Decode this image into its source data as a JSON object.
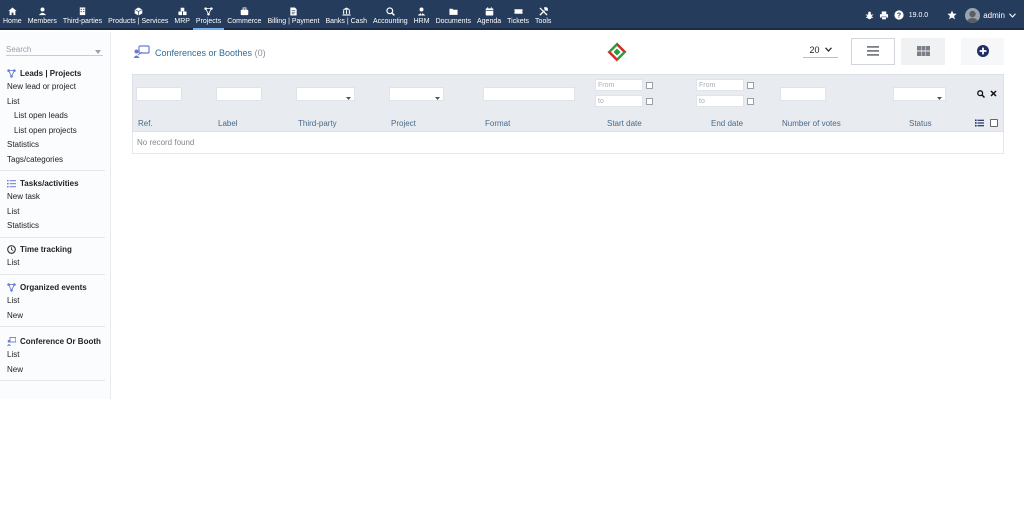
{
  "topnav": {
    "items": [
      {
        "label": "Home",
        "icon": "home-icon"
      },
      {
        "label": "Members",
        "icon": "user-icon"
      },
      {
        "label": "Third-parties",
        "icon": "building-icon"
      },
      {
        "label": "Products | Services",
        "icon": "cube-icon"
      },
      {
        "label": "MRP",
        "icon": "cubes-icon"
      },
      {
        "label": "Projects",
        "icon": "project-icon"
      },
      {
        "label": "Commerce",
        "icon": "suitcase-icon"
      },
      {
        "label": "Billing | Payment",
        "icon": "invoice-icon"
      },
      {
        "label": "Banks | Cash",
        "icon": "bank-icon"
      },
      {
        "label": "Accounting",
        "icon": "search-dollar-icon"
      },
      {
        "label": "HRM",
        "icon": "user-tie-icon"
      },
      {
        "label": "Documents",
        "icon": "folder-icon"
      },
      {
        "label": "Agenda",
        "icon": "calendar-icon"
      },
      {
        "label": "Tickets",
        "icon": "ticket-icon"
      },
      {
        "label": "Tools",
        "icon": "tools-icon"
      }
    ],
    "active": "Projects",
    "version": "19.0.0",
    "username": "admin"
  },
  "sidebar": {
    "search_placeholder": "Search",
    "sections": [
      {
        "title": "Leads | Projects",
        "icon": "project-icon",
        "items": [
          {
            "label": "New lead or project"
          },
          {
            "label": "List"
          },
          {
            "label": "List open leads",
            "sub": true
          },
          {
            "label": "List open projects",
            "sub": true
          },
          {
            "label": "Statistics"
          },
          {
            "label": "Tags/categories"
          }
        ]
      },
      {
        "title": "Tasks/activities",
        "icon": "tasks-icon",
        "items": [
          {
            "label": "New task"
          },
          {
            "label": "List"
          },
          {
            "label": "Statistics"
          }
        ]
      },
      {
        "title": "Time tracking",
        "icon": "clock-icon",
        "items": [
          {
            "label": "List"
          }
        ]
      },
      {
        "title": "Organized events",
        "icon": "project-icon",
        "items": [
          {
            "label": "List"
          },
          {
            "label": "New"
          }
        ]
      },
      {
        "title": "Conference Or Booth",
        "icon": "presentation-icon",
        "items": [
          {
            "label": "List"
          },
          {
            "label": "New"
          }
        ]
      }
    ]
  },
  "main": {
    "title": "Conferences or Boothes",
    "count": "(0)",
    "page_size": "20",
    "filters": {
      "from": "From",
      "to": "to"
    },
    "columns": [
      "Ref.",
      "Label",
      "Third-party",
      "Project",
      "Format",
      "Start date",
      "End date",
      "Number of votes",
      "Status"
    ],
    "empty_message": "No record found"
  }
}
